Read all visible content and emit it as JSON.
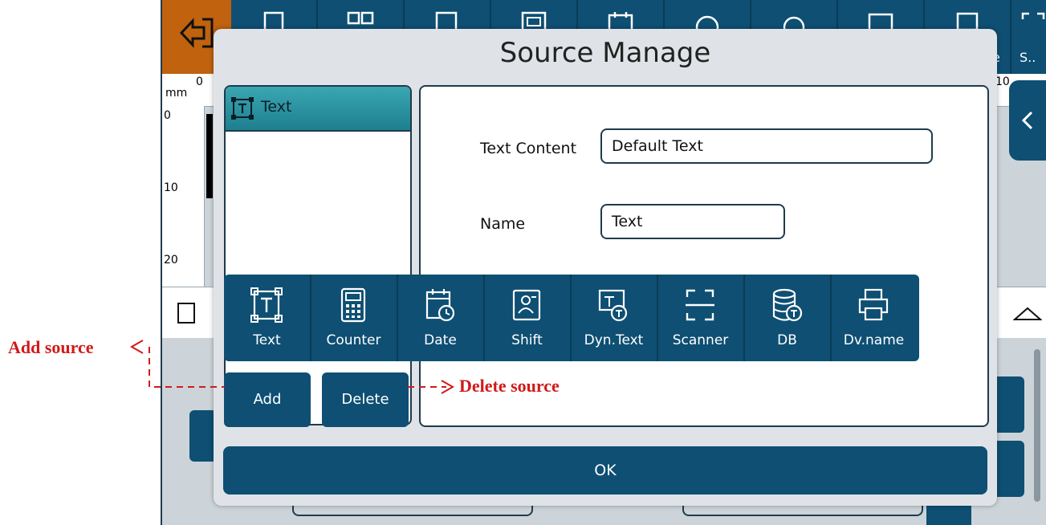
{
  "background": {
    "ruler_unit": "mm",
    "ruler_top_ticks": [
      "0",
      "10"
    ],
    "ruler_left_ticks": [
      "0",
      "10",
      "20"
    ],
    "toolbar_partial_labels": [
      "e",
      "S.."
    ]
  },
  "modal": {
    "title": "Source Manage",
    "source_list": [
      {
        "label": "Text",
        "icon": "text-frame-icon",
        "selected": true
      }
    ],
    "fields": {
      "text_content_label": "Text Content",
      "text_content_value": "Default Text",
      "name_label": "Name",
      "name_value": "Text"
    },
    "source_types": [
      {
        "label": "Text",
        "icon": "text-frame-icon"
      },
      {
        "label": "Counter",
        "icon": "calculator-icon"
      },
      {
        "label": "Date",
        "icon": "calendar-clock-icon"
      },
      {
        "label": "Shift",
        "icon": "person-badge-icon"
      },
      {
        "label": "Dyn.Text",
        "icon": "dynamic-text-icon"
      },
      {
        "label": "Scanner",
        "icon": "scanner-icon"
      },
      {
        "label": "DB",
        "icon": "database-icon"
      },
      {
        "label": "Dv.name",
        "icon": "printer-icon"
      }
    ],
    "add_label": "Add",
    "delete_label": "Delete",
    "ok_label": "OK"
  },
  "annotations": {
    "add": "Add source",
    "delete": "Delete source",
    "color": "#d11a1a"
  }
}
